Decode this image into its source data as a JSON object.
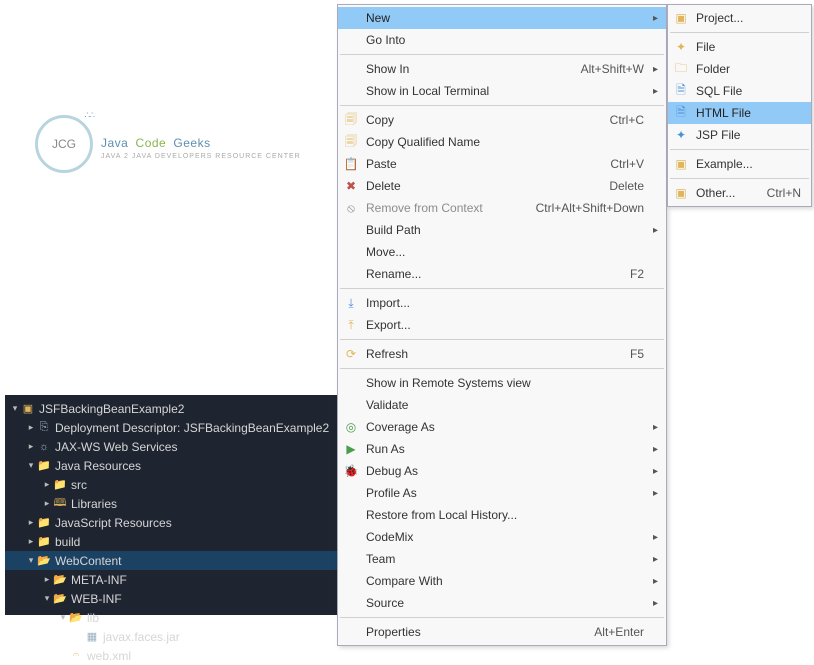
{
  "logo": {
    "short": "JCG",
    "title_java": "Java",
    "title_code": "Code",
    "title_geeks": "Geeks",
    "subtitle": "Java 2 Java Developers Resource Center"
  },
  "tree": {
    "project": "JSFBackingBeanExample2",
    "dd": "Deployment Descriptor: JSFBackingBeanExample2",
    "jaxws": "JAX-WS Web Services",
    "javares": "Java Resources",
    "src": "src",
    "libraries": "Libraries",
    "jsres": "JavaScript Resources",
    "build": "build",
    "webcontent": "WebContent",
    "metainf": "META-INF",
    "webinf": "WEB-INF",
    "lib": "lib",
    "jar": "javax.faces.jar",
    "webxml": "web.xml"
  },
  "menu": {
    "new": "New",
    "gointo": "Go Into",
    "showin": "Show In",
    "showin_k": "Alt+Shift+W",
    "showlocal": "Show in Local Terminal",
    "copy": "Copy",
    "copy_k": "Ctrl+C",
    "copyqn": "Copy Qualified Name",
    "paste": "Paste",
    "paste_k": "Ctrl+V",
    "delete": "Delete",
    "delete_k": "Delete",
    "remctx": "Remove from Context",
    "remctx_k": "Ctrl+Alt+Shift+Down",
    "buildpath": "Build Path",
    "move": "Move...",
    "rename": "Rename...",
    "rename_k": "F2",
    "import": "Import...",
    "export": "Export...",
    "refresh": "Refresh",
    "refresh_k": "F5",
    "showremote": "Show in Remote Systems view",
    "validate": "Validate",
    "coverage": "Coverage As",
    "runas": "Run As",
    "debugas": "Debug As",
    "profileas": "Profile As",
    "restore": "Restore from Local History...",
    "codemix": "CodeMix",
    "team": "Team",
    "compare": "Compare With",
    "source": "Source",
    "props": "Properties",
    "props_k": "Alt+Enter"
  },
  "submenu": {
    "project": "Project...",
    "file": "File",
    "folder": "Folder",
    "sql": "SQL File",
    "html": "HTML File",
    "jsp": "JSP File",
    "example": "Example...",
    "other": "Other...",
    "other_k": "Ctrl+N"
  }
}
